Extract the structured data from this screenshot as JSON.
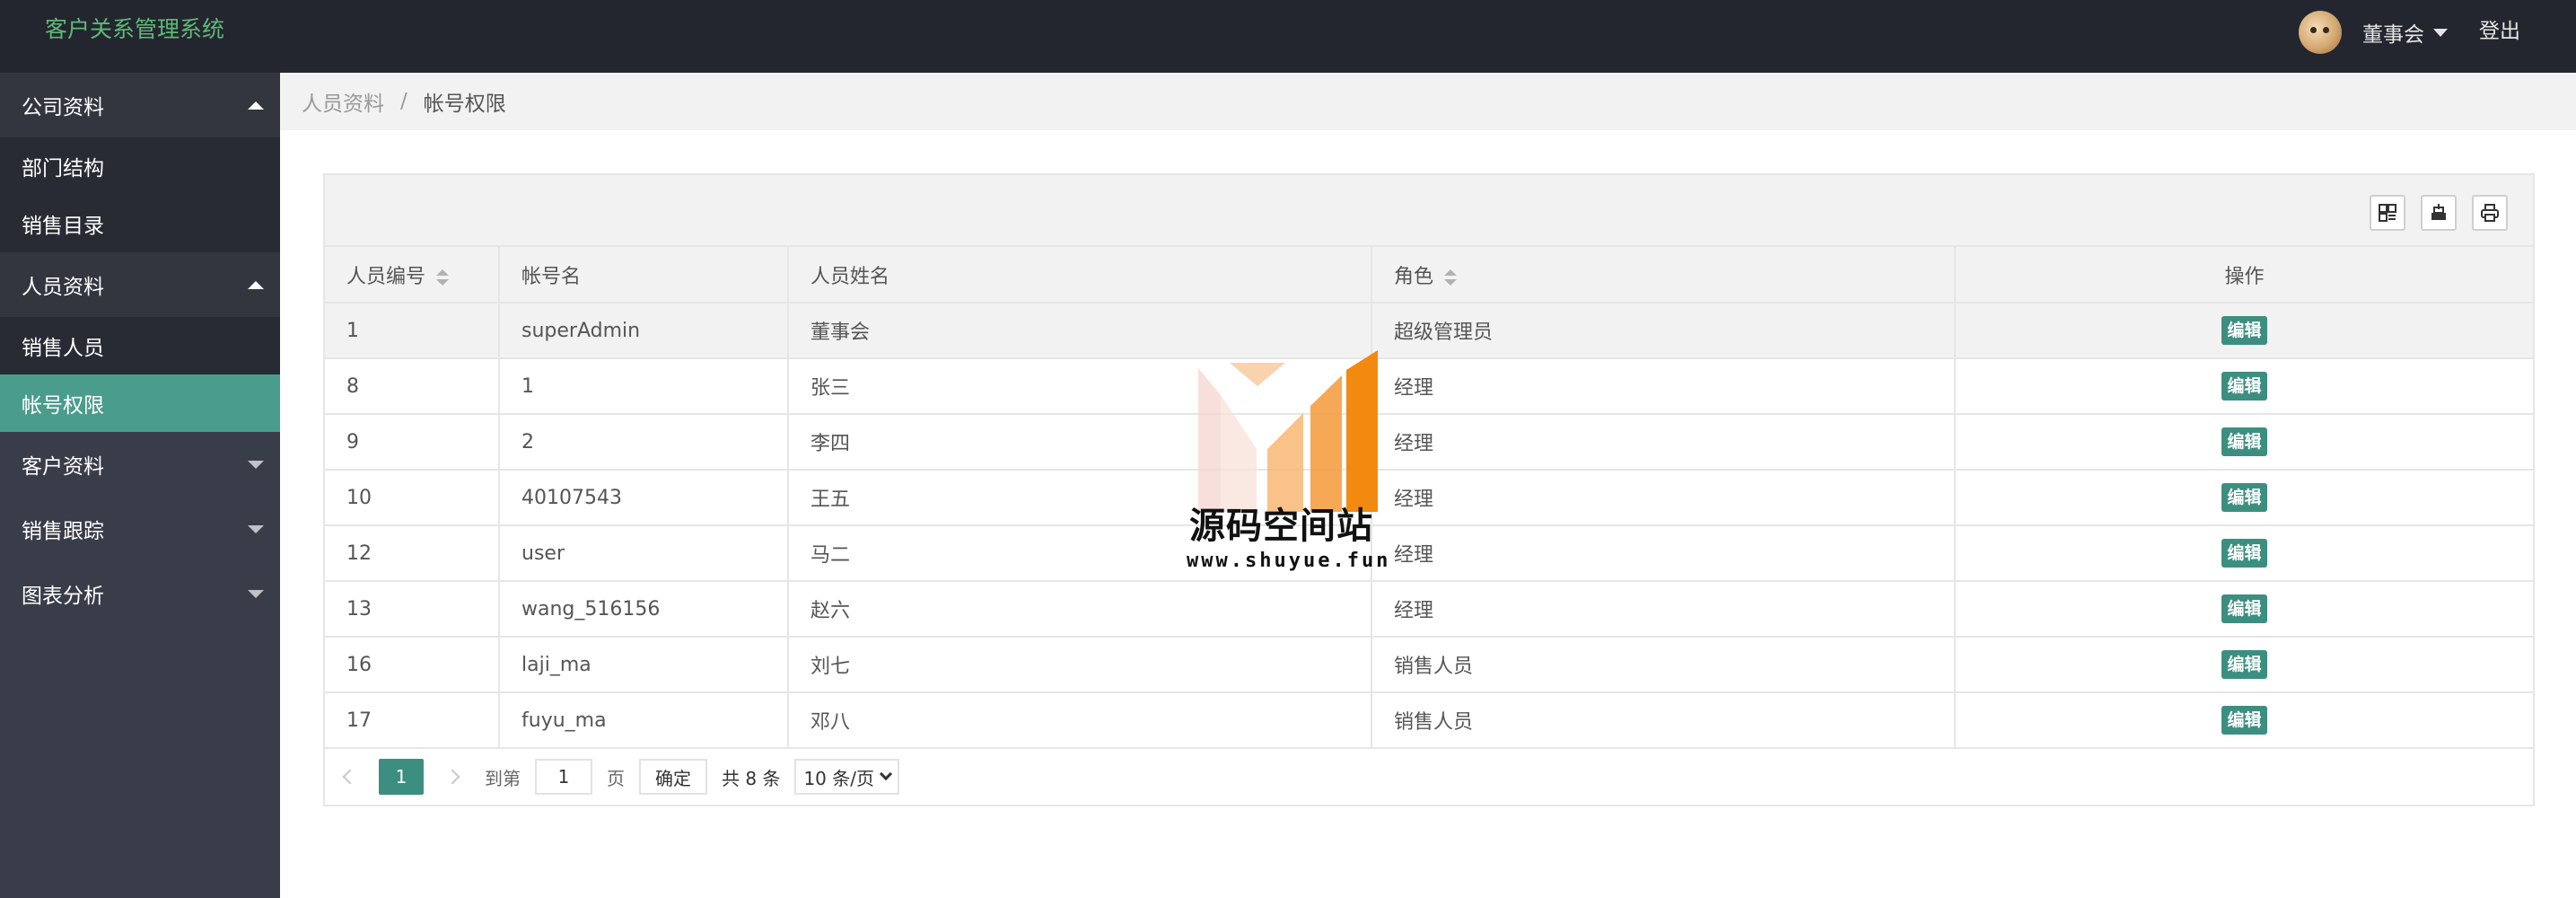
{
  "header": {
    "app_title": "客户关系管理系统",
    "user_name": "董事会",
    "logout_label": "登出"
  },
  "sidebar": {
    "groups": [
      {
        "label": "公司资料",
        "expanded": true,
        "items": [
          {
            "label": "部门结构"
          },
          {
            "label": "销售目录"
          }
        ]
      },
      {
        "label": "人员资料",
        "expanded": true,
        "items": [
          {
            "label": "销售人员"
          },
          {
            "label": "帐号权限",
            "active": true
          }
        ]
      },
      {
        "label": "客户资料",
        "expanded": false,
        "items": []
      },
      {
        "label": "销售跟踪",
        "expanded": false,
        "items": []
      },
      {
        "label": "图表分析",
        "expanded": false,
        "items": []
      }
    ]
  },
  "breadcrumb": {
    "parent": "人员资料",
    "separator": "/",
    "current": "帐号权限"
  },
  "table": {
    "columns": [
      "人员编号",
      "帐号名",
      "人员姓名",
      "角色",
      "操作"
    ],
    "sortable_columns": [
      "人员编号",
      "角色"
    ],
    "edit_label": "编辑",
    "rows": [
      {
        "id": "1",
        "account": "superAdmin",
        "name": "董事会",
        "role": "超级管理员"
      },
      {
        "id": "8",
        "account": "1",
        "name": "张三",
        "role": "经理"
      },
      {
        "id": "9",
        "account": "2",
        "name": "李四",
        "role": "经理"
      },
      {
        "id": "10",
        "account": "40107543",
        "name": "王五",
        "role": "经理"
      },
      {
        "id": "12",
        "account": "user",
        "name": "马二",
        "role": "经理"
      },
      {
        "id": "13",
        "account": "wang_516156",
        "name": "赵六",
        "role": "经理"
      },
      {
        "id": "16",
        "account": "laji_ma",
        "name": "刘七",
        "role": "销售人员"
      },
      {
        "id": "17",
        "account": "fuyu_ma",
        "name": "邓八",
        "role": "销售人员"
      }
    ]
  },
  "pagination": {
    "current_page": "1",
    "goto_label": "到第",
    "page_input_value": "1",
    "page_unit": "页",
    "confirm_label": "确定",
    "total_text": "共 8 条",
    "page_size": "10 条/页"
  },
  "watermark": {
    "title": "源码空间站",
    "url": "www.shuyue.fun"
  },
  "colors": {
    "header_bg": "#23262e",
    "sidebar_bg": "#393d49",
    "accent": "#3c8f80",
    "logo": "#5fb878"
  }
}
